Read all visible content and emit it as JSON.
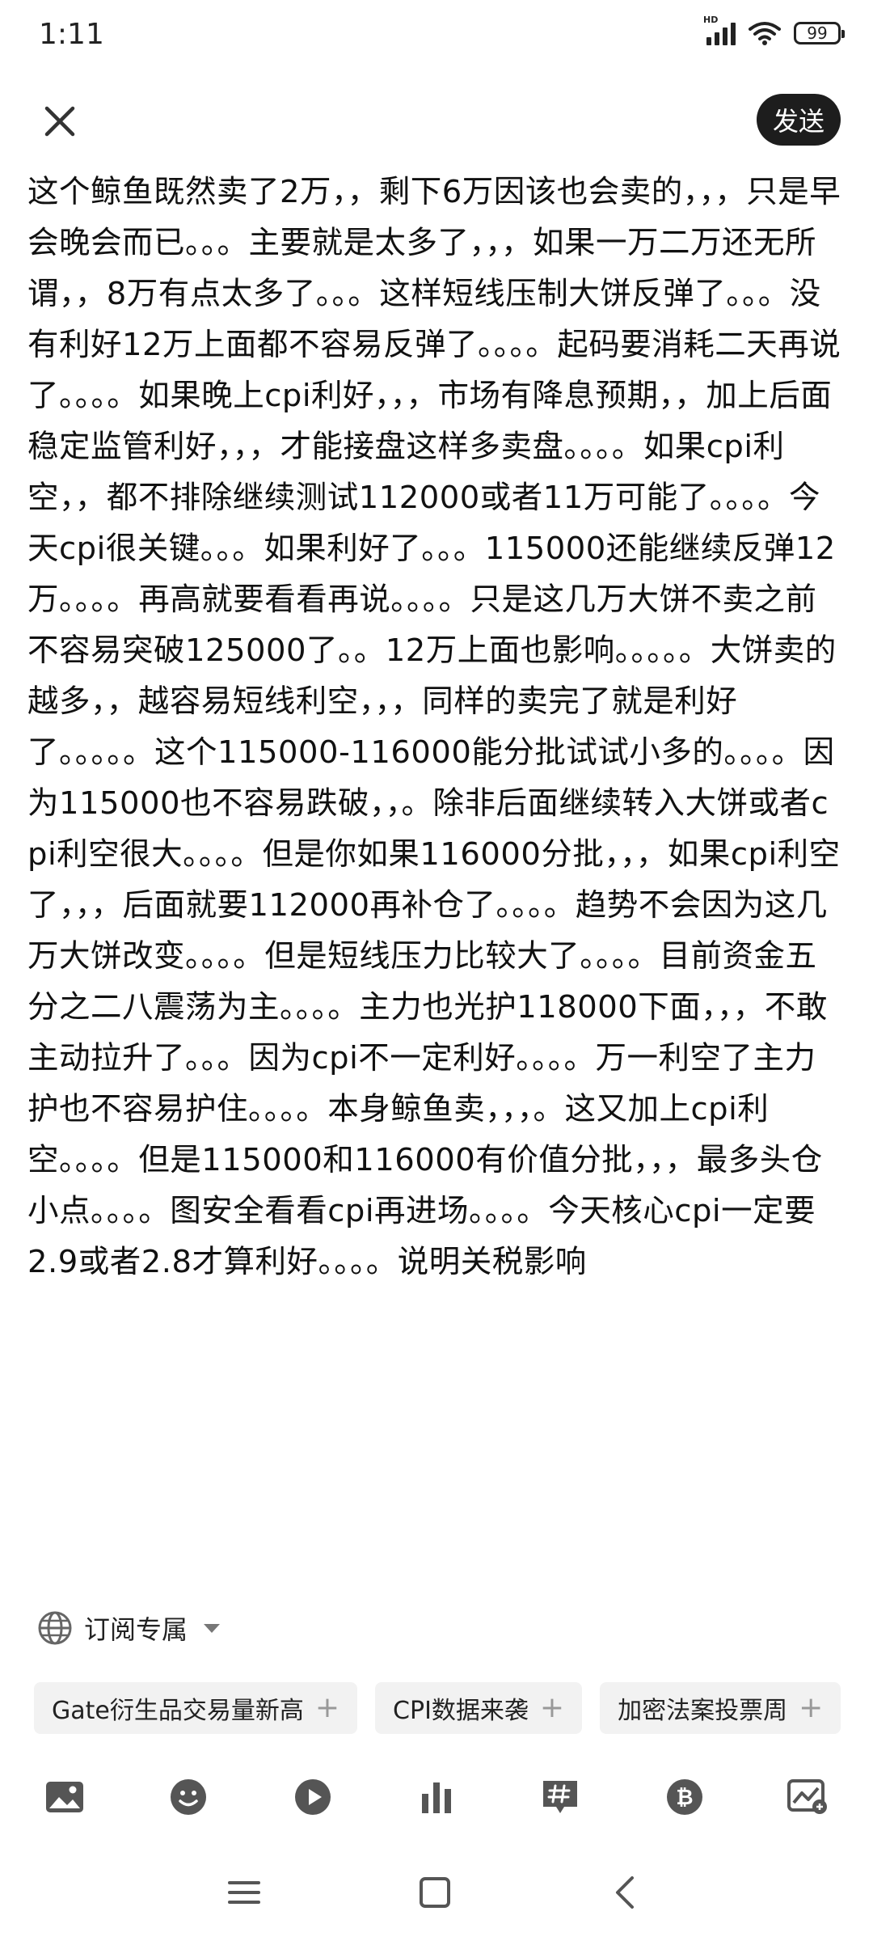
{
  "status_bar": {
    "time": "1:11",
    "network": "HD",
    "battery": "99"
  },
  "header": {
    "send_label": "发送"
  },
  "post": {
    "text": "这个鲸鱼既然卖了2万，，剩下6万因该也会卖的，，，只是早会晚会而已。。。主要就是太多了，，，如果一万二万还无所谓，，8万有点太多了。。。这样短线压制大饼反弹了。。。没有利好12万上面都不容易反弹了。。。。起码要消耗二天再说了。。。。如果晚上cpi利好，，，市场有降息预期，，加上后面稳定监管利好，，，才能接盘这样多卖盘。。。。如果cpi利空，，都不排除继续测试112000或者11万可能了。。。。今天cpi很关键。。。如果利好了。。。115000还能继续反弹12万。。。。再高就要看看再说。。。。只是这几万大饼不卖之前不容易突破125000了。。12万上面也影响。。。。。大饼卖的越多，，越容易短线利空，，，同样的卖完了就是利好了。。。。。这个115000-116000能分批试试小多的。。。。因为115000也不容易跌破，，。除非后面继续转入大饼或者cpi利空很大。。。。但是你如果116000分批，，，如果cpi利空了，，，后面就要112000再补仓了。。。。趋势不会因为这几万大饼改变。。。。但是短线压力比较大了。。。。目前资金五分之二八震荡为主。。。。主力也光护118000下面，，，不敢主动拉升了。。。因为cpi不一定利好。。。。万一利空了主力护也不容易护住。。。。本身鲸鱼卖，，，。这又加上cpi利空。。。。但是115000和116000有价值分批，，，最多头仓小点。。。。图安全看看cpi再进场。。。。今天核心cpi一定要2.9或者2.8才算利好。。。。说明关税影响"
  },
  "subscription": {
    "label": "订阅专属"
  },
  "tags": [
    {
      "label": "Gate衍生品交易量新高"
    },
    {
      "label": "CPI数据来袭"
    },
    {
      "label": "加密法案投票周"
    }
  ],
  "toolbar": {
    "items": [
      "image-icon",
      "emoji-icon",
      "video-icon",
      "chart-icon",
      "hashtag-icon",
      "bitcoin-icon",
      "trend-image-icon"
    ]
  },
  "colors": {
    "send_bg": "#1d1d1d",
    "icon": "#555555",
    "tag_bg": "#f2f2f2"
  }
}
